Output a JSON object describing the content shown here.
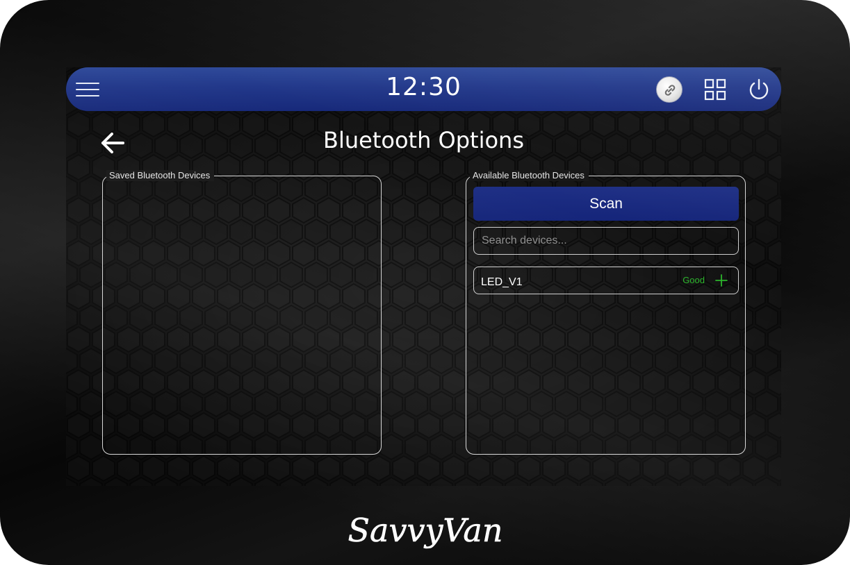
{
  "header": {
    "time": "12:30",
    "icons": [
      "menu-icon",
      "link-icon",
      "grid-icon",
      "power-icon"
    ]
  },
  "page": {
    "title": "Bluetooth Options",
    "back_icon": "arrow-left-icon"
  },
  "saved_panel": {
    "legend": "Saved Bluetooth Devices",
    "devices": []
  },
  "available_panel": {
    "legend": "Available Bluetooth Devices",
    "scan_label": "Scan",
    "search_placeholder": "Search devices...",
    "search_value": "",
    "devices": [
      {
        "name": "LED_V1",
        "signal": "Good",
        "action_icon": "plus-icon"
      }
    ]
  },
  "brand": {
    "logo_text": "SavvyVan"
  },
  "colors": {
    "header_blue": "#22388a",
    "button_blue": "#1a2a80",
    "signal_good": "#2bb52b",
    "background": "#151515"
  }
}
